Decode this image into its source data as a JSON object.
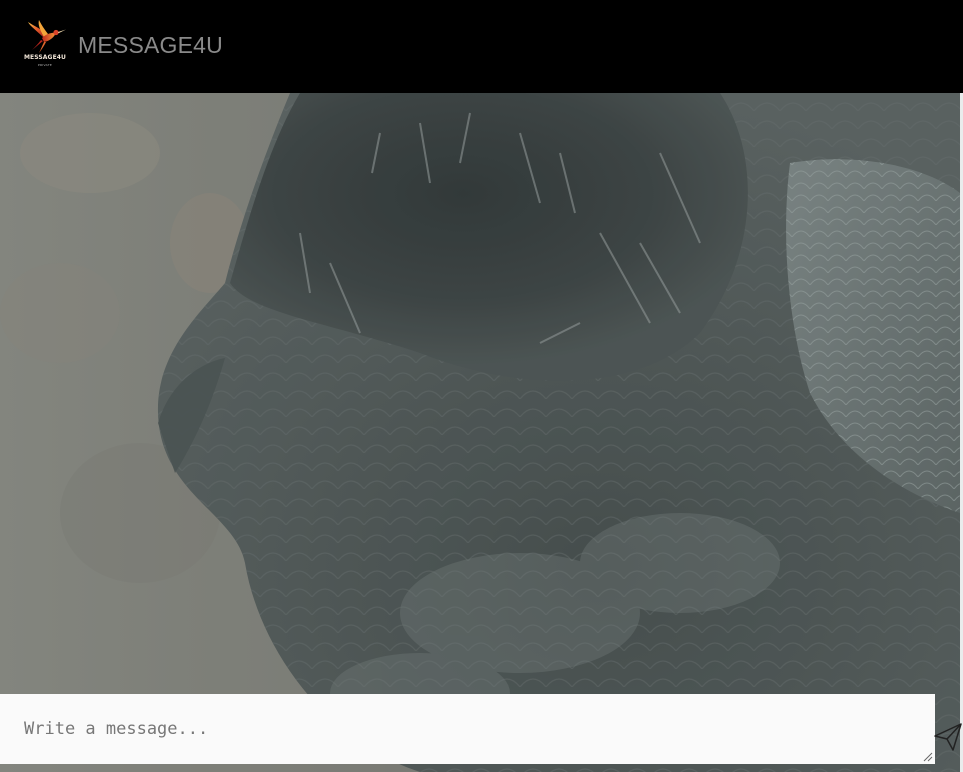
{
  "header": {
    "logo_text": "MESSAGE4U",
    "logo_sub": "PRIVATE",
    "app_title": "MESSAGE4U"
  },
  "background": {
    "icon": "raven-photo"
  },
  "composer": {
    "placeholder": "Write a message...",
    "value": ""
  },
  "send": {
    "icon": "paper-plane-icon"
  },
  "colors": {
    "header_bg": "#000000",
    "title_color": "#8a8a8a",
    "composer_bg": "#fafafa"
  }
}
